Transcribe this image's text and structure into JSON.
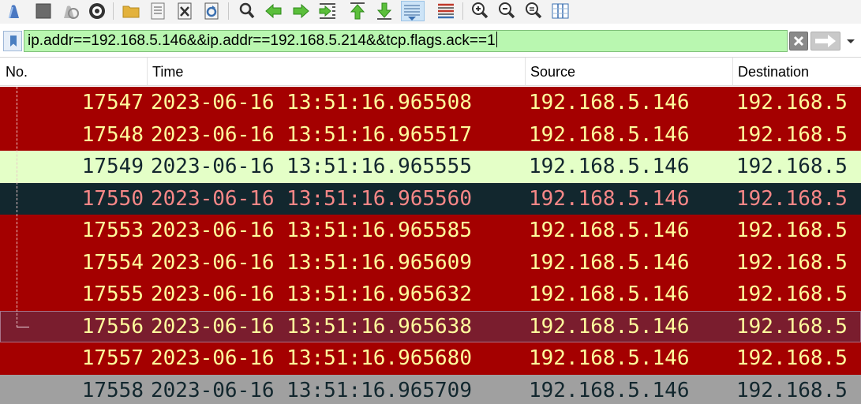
{
  "toolbar": {
    "buttons": [
      {
        "name": "start-capture-icon",
        "color": "#4a78c2"
      },
      {
        "name": "stop-capture-icon",
        "color": "#6b6b6b"
      },
      {
        "name": "restart-capture-icon",
        "color": "#9a9a9a"
      },
      {
        "name": "capture-options-icon",
        "color": "#333333"
      },
      {
        "name": "open-file-icon",
        "color": "#e3b23c"
      },
      {
        "name": "save-file-icon",
        "color": "#6a6a6a"
      },
      {
        "name": "close-file-icon",
        "color": "#555555"
      },
      {
        "name": "reload-file-icon",
        "color": "#3a6fb0"
      },
      {
        "name": "find-packet-icon",
        "color": "#333333"
      },
      {
        "name": "go-back-icon",
        "color": "#3aa53a"
      },
      {
        "name": "go-forward-icon",
        "color": "#3aa53a"
      },
      {
        "name": "go-to-packet-icon",
        "color": "#3aa53a"
      },
      {
        "name": "go-first-icon",
        "color": "#3aa53a"
      },
      {
        "name": "go-last-icon",
        "color": "#3aa53a"
      },
      {
        "name": "auto-scroll-icon",
        "color": "#3a6fb0"
      },
      {
        "name": "colorize-icon",
        "color": "#c0392b"
      },
      {
        "name": "zoom-in-icon",
        "color": "#333333"
      },
      {
        "name": "zoom-out-icon",
        "color": "#333333"
      },
      {
        "name": "normal-size-icon",
        "color": "#333333"
      },
      {
        "name": "resize-columns-icon",
        "color": "#3a6fb0"
      }
    ]
  },
  "filter": {
    "value": "ip.addr==192.168.5.146&&ip.addr==192.168.5.214&&tcp.flags.ack==1",
    "background": "#b9f7b0"
  },
  "packet_list": {
    "columns": [
      "No.",
      "Time",
      "Source",
      "Destination"
    ],
    "rows": [
      {
        "no": "17547",
        "time": "2023-06-16 13:51:16.965508",
        "source": "192.168.5.146",
        "destination": "192.168.5",
        "bg": "#a40000",
        "fg": "#fffc9c",
        "selected": false
      },
      {
        "no": "17548",
        "time": "2023-06-16 13:51:16.965517",
        "source": "192.168.5.146",
        "destination": "192.168.5",
        "bg": "#a40000",
        "fg": "#fffc9c",
        "selected": false
      },
      {
        "no": "17549",
        "time": "2023-06-16 13:51:16.965555",
        "source": "192.168.5.146",
        "destination": "192.168.5",
        "bg": "#e4ffc7",
        "fg": "#12272e",
        "selected": false
      },
      {
        "no": "17550",
        "time": "2023-06-16 13:51:16.965560",
        "source": "192.168.5.146",
        "destination": "192.168.5",
        "bg": "#12272e",
        "fg": "#f78787",
        "selected": false
      },
      {
        "no": "17553",
        "time": "2023-06-16 13:51:16.965585",
        "source": "192.168.5.146",
        "destination": "192.168.5",
        "bg": "#a40000",
        "fg": "#fffc9c",
        "selected": false
      },
      {
        "no": "17554",
        "time": "2023-06-16 13:51:16.965609",
        "source": "192.168.5.146",
        "destination": "192.168.5",
        "bg": "#a40000",
        "fg": "#fffc9c",
        "selected": false
      },
      {
        "no": "17555",
        "time": "2023-06-16 13:51:16.965632",
        "source": "192.168.5.146",
        "destination": "192.168.5",
        "bg": "#a40000",
        "fg": "#fffc9c",
        "selected": false
      },
      {
        "no": "17556",
        "time": "2023-06-16 13:51:16.965638",
        "source": "192.168.5.146",
        "destination": "192.168.5",
        "bg": "#7a1d2e",
        "fg": "#fffc9c",
        "selected": true
      },
      {
        "no": "17557",
        "time": "2023-06-16 13:51:16.965680",
        "source": "192.168.5.146",
        "destination": "192.168.5",
        "bg": "#a40000",
        "fg": "#fffc9c",
        "selected": false
      },
      {
        "no": "17558",
        "time": "2023-06-16 13:51:16.965709",
        "source": "192.168.5.146",
        "destination": "192.168.5",
        "bg": "#a0a0a0",
        "fg": "#12272e",
        "selected": false
      }
    ]
  }
}
